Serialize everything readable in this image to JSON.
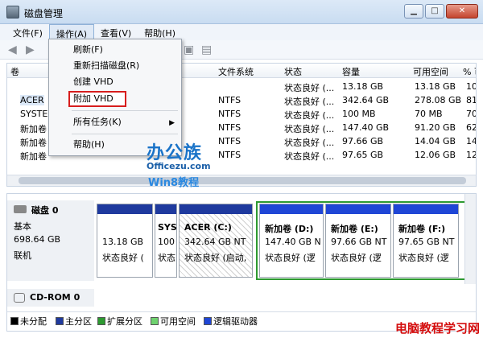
{
  "window": {
    "title": "磁盘管理"
  },
  "menu": {
    "items": [
      "文件(F)",
      "操作(A)",
      "查看(V)",
      "帮助(H)"
    ]
  },
  "dropdown": {
    "items": [
      "刷新(F)",
      "重新扫描磁盘(R)",
      "创建 VHD",
      "附加 VHD",
      "所有任务(K)",
      "帮助(H)"
    ],
    "highlighted": "附加 VHD"
  },
  "list": {
    "columns": [
      "卷",
      "文件系统",
      "状态",
      "容量",
      "可用空间",
      "% 可"
    ],
    "rows": [
      {
        "volume": "",
        "fs": "",
        "status": "状态良好 (...",
        "capacity": "13.18 GB",
        "free": "13.18 GB",
        "pct": "10"
      },
      {
        "volume": "ACER",
        "fs": "NTFS",
        "status": "状态良好 (...",
        "capacity": "342.64 GB",
        "free": "278.08 GB",
        "pct": "81"
      },
      {
        "volume": "SYSTE",
        "fs": "NTFS",
        "status": "状态良好 (...",
        "capacity": "100 MB",
        "free": "70 MB",
        "pct": "70"
      },
      {
        "volume": "新加卷",
        "fs": "NTFS",
        "status": "状态良好 (...",
        "capacity": "147.40 GB",
        "free": "91.20 GB",
        "pct": "62"
      },
      {
        "volume": "新加卷",
        "fs": "NTFS",
        "status": "状态良好 (...",
        "capacity": "97.66 GB",
        "free": "14.04 GB",
        "pct": "14"
      },
      {
        "volume": "新加卷",
        "fs": "NTFS",
        "status": "状态良好 (...",
        "capacity": "97.65 GB",
        "free": "12.06 GB",
        "pct": "12"
      }
    ]
  },
  "watermark": {
    "line1": "办公族",
    "line2": "Officezu.com",
    "line3": "Win8教程",
    "bottom": "电脑教程学习网"
  },
  "disk0": {
    "name": "磁盘 0",
    "type": "基本",
    "size": "698.64 GB",
    "status": "联机"
  },
  "partitions": [
    {
      "label": "",
      "size": "13.18 GB",
      "status": "状态良好 ("
    },
    {
      "label": "SYS",
      "size": "100",
      "status": "状态"
    },
    {
      "label": "ACER (C:)",
      "size": "342.64 GB NT",
      "status": "状态良好 (启动,"
    },
    {
      "label": "新加卷 (D:)",
      "size": "147.40 GB N",
      "status": "状态良好 (逻"
    },
    {
      "label": "新加卷 (E:)",
      "size": "97.66 GB NT",
      "status": "状态良好 (逻"
    },
    {
      "label": "新加卷 (F:)",
      "size": "97.65 GB NT",
      "status": "状态良好 (逻"
    }
  ],
  "cdrom": {
    "name": "CD-ROM 0"
  },
  "legend": {
    "items": [
      "未分配",
      "主分区",
      "扩展分区",
      "可用空间",
      "逻辑驱动器"
    ],
    "colors": [
      "#000000",
      "#1f3a9e",
      "#2d9a31",
      "#6fd26f",
      "#1f46d6"
    ]
  }
}
